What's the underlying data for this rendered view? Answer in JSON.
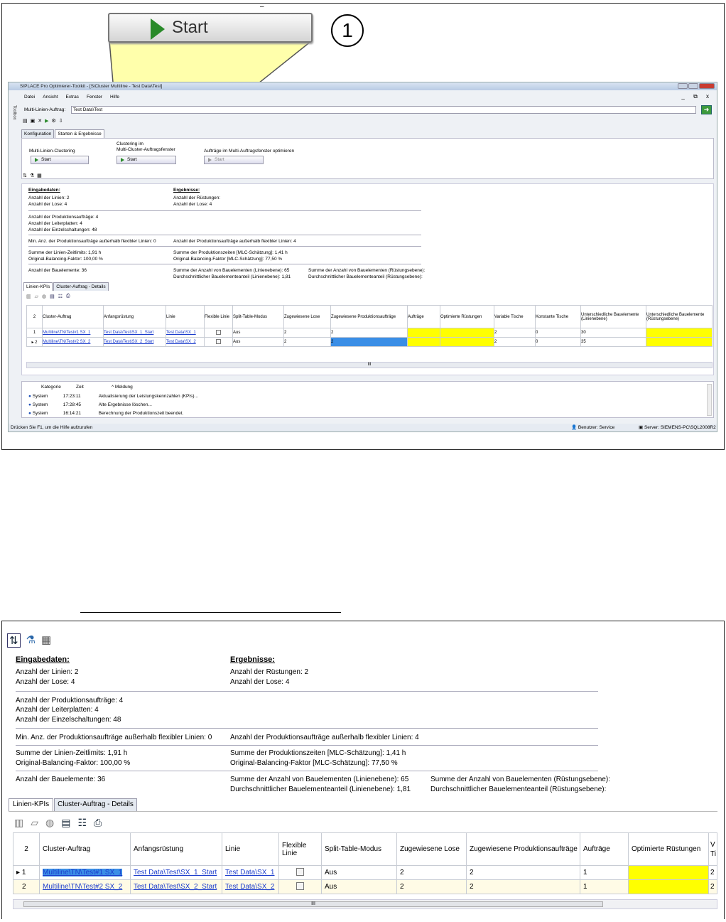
{
  "top": {
    "dash": "–",
    "big_start_label": "Start",
    "callout_number": "1"
  },
  "window": {
    "title": "SIPLACE Pro Optimierer-Toolkit - [SiCluster Multiline - Test Data\\Test]",
    "menu": [
      "Datei",
      "Ansicht",
      "Extras",
      "Fenster",
      "Hilfe"
    ],
    "mdi_controls": "_ ⧉ x",
    "toolbox_label": "Toolbox",
    "mla_label": "Multi-Linien-Auftrag:",
    "mla_value": "Test Data\\Test",
    "tabs": [
      "Konfiguration",
      "Starten & Ergebnisse"
    ],
    "sections": {
      "clustering_label": "Multi-Linien-Clustering",
      "clustering_fenster_label": "Clustering im\nMulti-Cluster-Auftragsfenster",
      "optimieren_label": "Aufträge im Multi-Auftragsfenster optimieren",
      "start": "Start"
    },
    "status_left": "Drücken Sie F1, um die Hilfe aufzurufen",
    "status_user": "Benutzer: Service",
    "status_server": "Server: SIEMENS-PC\\SQL2008R2"
  },
  "info": {
    "eingabedaten": "Eingabedaten:",
    "ergebnisse": "Ergebnisse:",
    "anz_linien": "Anzahl der Linien: 2",
    "anz_lose": "Anzahl der Lose: 4",
    "anz_ruestungen": "Anzahl der Rüstungen: 2",
    "anz_lose_r": "Anzahl der Lose: 4",
    "anz_ruestungen_small": "Anzahl der Rüstungen:",
    "anz_prod": "Anzahl der Produktionsaufträge: 4",
    "anz_leiter": "Anzahl der Leiterplatten: 4",
    "anz_einzel": "Anzahl der Einzelschaltungen: 48",
    "min_anz": "Min. Anz. der Produktionsaufträge außerhalb flexibler Linien: 0",
    "anz_ausser": "Anzahl der Produktionsaufträge außerhalb flexibler Linien: 4",
    "summe_linien": "Summe der Linien-Zeitlimits: 1,91 h",
    "orig_bal": "Original-Balancing-Faktor: 100,00 %",
    "summe_prod": "Summe der Produktionszeiten [MLC-Schätzung]: 1,41 h",
    "orig_bal_mlc": "Original-Balancing-Faktor [MLC-Schätzung]: 77,50 %",
    "anz_bauelemente": "Anzahl der Bauelemente: 36",
    "summe_bau_linie": "Summe der Anzahl von Bauelementen (Linienebene): 65",
    "durch_linie": "Durchschnittlicher Bauelementeanteil (Linienebene): 1,81",
    "summe_bau_ruest": "Summe der Anzahl von Bauelementen (Rüstungsebene):",
    "durch_ruest": "Durchschnittlicher Bauelementeanteil (Rüstungsebene):"
  },
  "subtabs": [
    "Linien-KPIs",
    "Cluster-Auftrag - Details"
  ],
  "table": {
    "headers": [
      "2",
      "Cluster-Auftrag",
      "Anfangsrüstung",
      "Linie",
      "Flexible Linie",
      "Split-Table-Modus",
      "Zugewiesene Lose",
      "Zugewiesene Produktionsaufträge",
      "Aufträge",
      "Optimierte Rüstungen",
      "Variable Tische",
      "Konstante Tische",
      "Unterschiedliche Bauelemente (Linienebene)",
      "Unterschiedliche Bauelemente (Rüstungsebene)"
    ],
    "rows_top": [
      {
        "n": "1",
        "cluster": "Multiline\\TN\\Test#1 SX_1",
        "anfang": "Test Data\\Test\\SX_1_Start",
        "linie": "Test Data\\SX_1",
        "split": "Aus",
        "lose": "2",
        "prod": "2",
        "variable": "2",
        "konstante": "0",
        "ul": "30"
      },
      {
        "n": "2",
        "cluster": "Multiline\\TN\\Test#2 SX_2",
        "anfang": "Test Data\\Test\\SX_2_Start",
        "linie": "Test Data\\SX_2",
        "split": "Aus",
        "lose": "2",
        "prod": "2",
        "variable": "2",
        "konstante": "0",
        "ul": "35"
      }
    ],
    "rows_bottom": [
      {
        "n": "1",
        "cluster": "Multiline\\TN\\Test#1 SX_1",
        "anfang": "Test Data\\Test\\SX_1_Start",
        "linie": "Test Data\\SX_1",
        "split": "Aus",
        "lose": "2",
        "prod": "2",
        "auftraege": "1",
        "variable": "2"
      },
      {
        "n": "2",
        "cluster": "Multiline\\TN\\Test#2 SX_2",
        "anfang": "Test Data\\Test\\SX_2_Start",
        "linie": "Test Data\\SX_2",
        "split": "Aus",
        "lose": "2",
        "prod": "2",
        "auftraege": "1",
        "variable": "2"
      }
    ],
    "bottom_cut_header": "V\nTi",
    "scroll_grip": "III"
  },
  "log": {
    "headers": [
      "Kategorie",
      "Zeit",
      "^ Meldung"
    ],
    "rows": [
      {
        "kat": "System",
        "zeit": "17:23:11",
        "msg": "Aktualisierung der Leistungskennzahlen (KPIs)..."
      },
      {
        "kat": "System",
        "zeit": "17:28:45",
        "msg": "Alte Ergebnisse löschen..."
      },
      {
        "kat": "System",
        "zeit": "16:14:21",
        "msg": "Berechnung der Produktionszeit beendet."
      }
    ]
  },
  "colors": {
    "yellow": "#ffff00",
    "selection": "#3a8ee6",
    "link": "#1b3ccc",
    "green": "#2a8a2a"
  }
}
